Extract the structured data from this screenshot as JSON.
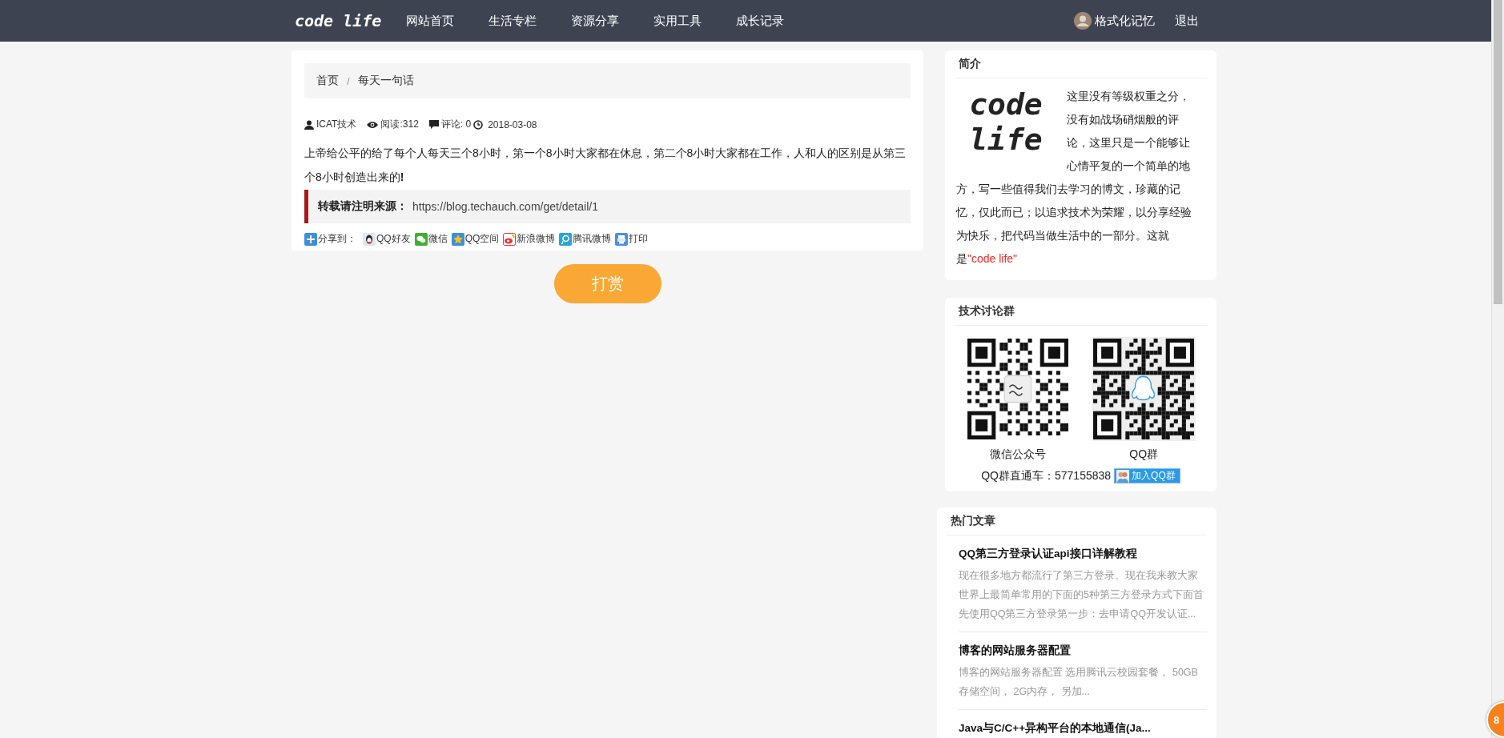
{
  "nav": {
    "logo": "code life",
    "links": [
      "网站首页",
      "生活专栏",
      "资源分享",
      "实用工具",
      "成长记录"
    ],
    "user": "格式化记忆",
    "logout": "退出"
  },
  "breadcrumb": [
    "首页",
    "/",
    "每天一句话"
  ],
  "meta": {
    "author": "ICAT技术",
    "reads": "阅读:312",
    "comments": "评论: 0",
    "date": "2018-03-08"
  },
  "body": "上帝给公平的给了每个人每天三个8小时，第一个8小时大家都在休息，第二个8小时大家都在工作，人和人的区别是从第三个8小时创造出来的**!**",
  "source": {
    "label": "转载请注明来源：",
    "url": "https://blog.techauch.com/get/detail/1"
  },
  "share": {
    "label": "分享到：",
    "items": [
      {
        "kind": "qq",
        "label": "QQ好友"
      },
      {
        "kind": "wechat",
        "label": "微信"
      },
      {
        "kind": "qzone",
        "label": "QQ空间"
      },
      {
        "kind": "weibo",
        "label": "新浪微博"
      },
      {
        "kind": "tweibo",
        "label": "腾讯微博"
      },
      {
        "kind": "print",
        "label": "打印"
      }
    ]
  },
  "reward_button": "打赏",
  "intro": {
    "title": "简介",
    "logo": "code life",
    "text": "这里没有等级权重之分，没有如战场硝烟般的评论，这里只是一个能够让心情平复的一个简单的地方，写一些值得我们去学习的博文，珍藏的记忆，仅此而已；以追求技术为荣耀，以分享经验为快乐，把代码当做生活中的一部分。这就是",
    "highlight": "\"code life\""
  },
  "groups": {
    "title": "技术讨论群",
    "qrs": [
      {
        "kind": "wechat",
        "caption": "微信公众号"
      },
      {
        "kind": "qq",
        "caption": "QQ群"
      }
    ],
    "direct": "QQ群直通车：577155838",
    "join_button": "加入QQ群"
  },
  "hot": {
    "title": "热门文章",
    "articles": [
      {
        "title": "QQ第三方登录认证api接口详解教程",
        "summary": "现在很多地方都流行了第三方登录。现在我来教大家世界上最简单常用的下面的5种第三方登录方式下面首先使用QQ第三方登录第一步：去申请QQ开发认证..."
      },
      {
        "title": "博客的网站服务器配置",
        "summary": "博客的网站服务器配置 选用腾讯云校园套餐， 50GB存储空间， 2G内存， 另加..."
      },
      {
        "title": "Java与C/C++异构平台的本地通信(Ja..."
      }
    ]
  },
  "float_badge": "8"
}
